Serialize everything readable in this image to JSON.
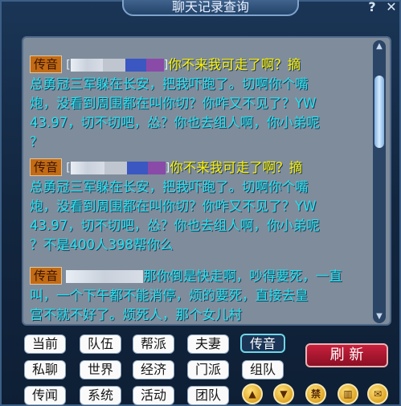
{
  "window": {
    "title": "聊天记录查询",
    "help": "?",
    "close": "✕"
  },
  "messages": [
    {
      "channel": "传音",
      "bracket_open": "[",
      "bracket_close": "]",
      "lines": [
        "你不来我可走了啊？摘",
        "总勇冠三军躲在长安，把我吓跑了。切啊你个嘴",
        "炮，没看到周围都在叫你切？你咋又不见了？YW",
        "43.97，切不切吧，怂？你也去组人啊，你小弟呢",
        "？"
      ]
    },
    {
      "channel": "传音",
      "bracket_open": "[",
      "bracket_close": "]",
      "lines": [
        "你不来我可走了啊？摘",
        "总勇冠三军躲在长安，把我吓跑了。切啊你个嘴",
        "炮，没看到周围都在叫你切？你咋又不见了？YW",
        "43.97，切不切吧，怂？你也去组人啊，你小弟呢",
        "？不是400人398帮你么"
      ]
    },
    {
      "channel": "传音",
      "lines": [
        "那你倒是快走啊，吵得要死，一直",
        "叫，一个下午都不能消停，烦的要死，直接去皇",
        "宫不就不好了。烦死人，那个女儿村"
      ]
    }
  ],
  "tabs": {
    "row1": [
      "当前",
      "队伍",
      "帮派",
      "夫妻",
      "传音"
    ],
    "row2": [
      "私聊",
      "世界",
      "经济",
      "门派",
      "组队"
    ],
    "row3": [
      "传闻",
      "系统",
      "活动",
      "团队"
    ],
    "active": "传音"
  },
  "refresh_label": "刷 新",
  "icons": {
    "up": "▲",
    "down": "▼",
    "forbid": "禁",
    "grid": "▥",
    "mail": "✉"
  },
  "colors": {
    "message_text": "#27e2ee",
    "highlight_text": "#fff200",
    "channel_tag": "#c26a14",
    "active_tab_border": "#6fd6e8",
    "refresh_button": "#c8203c"
  }
}
